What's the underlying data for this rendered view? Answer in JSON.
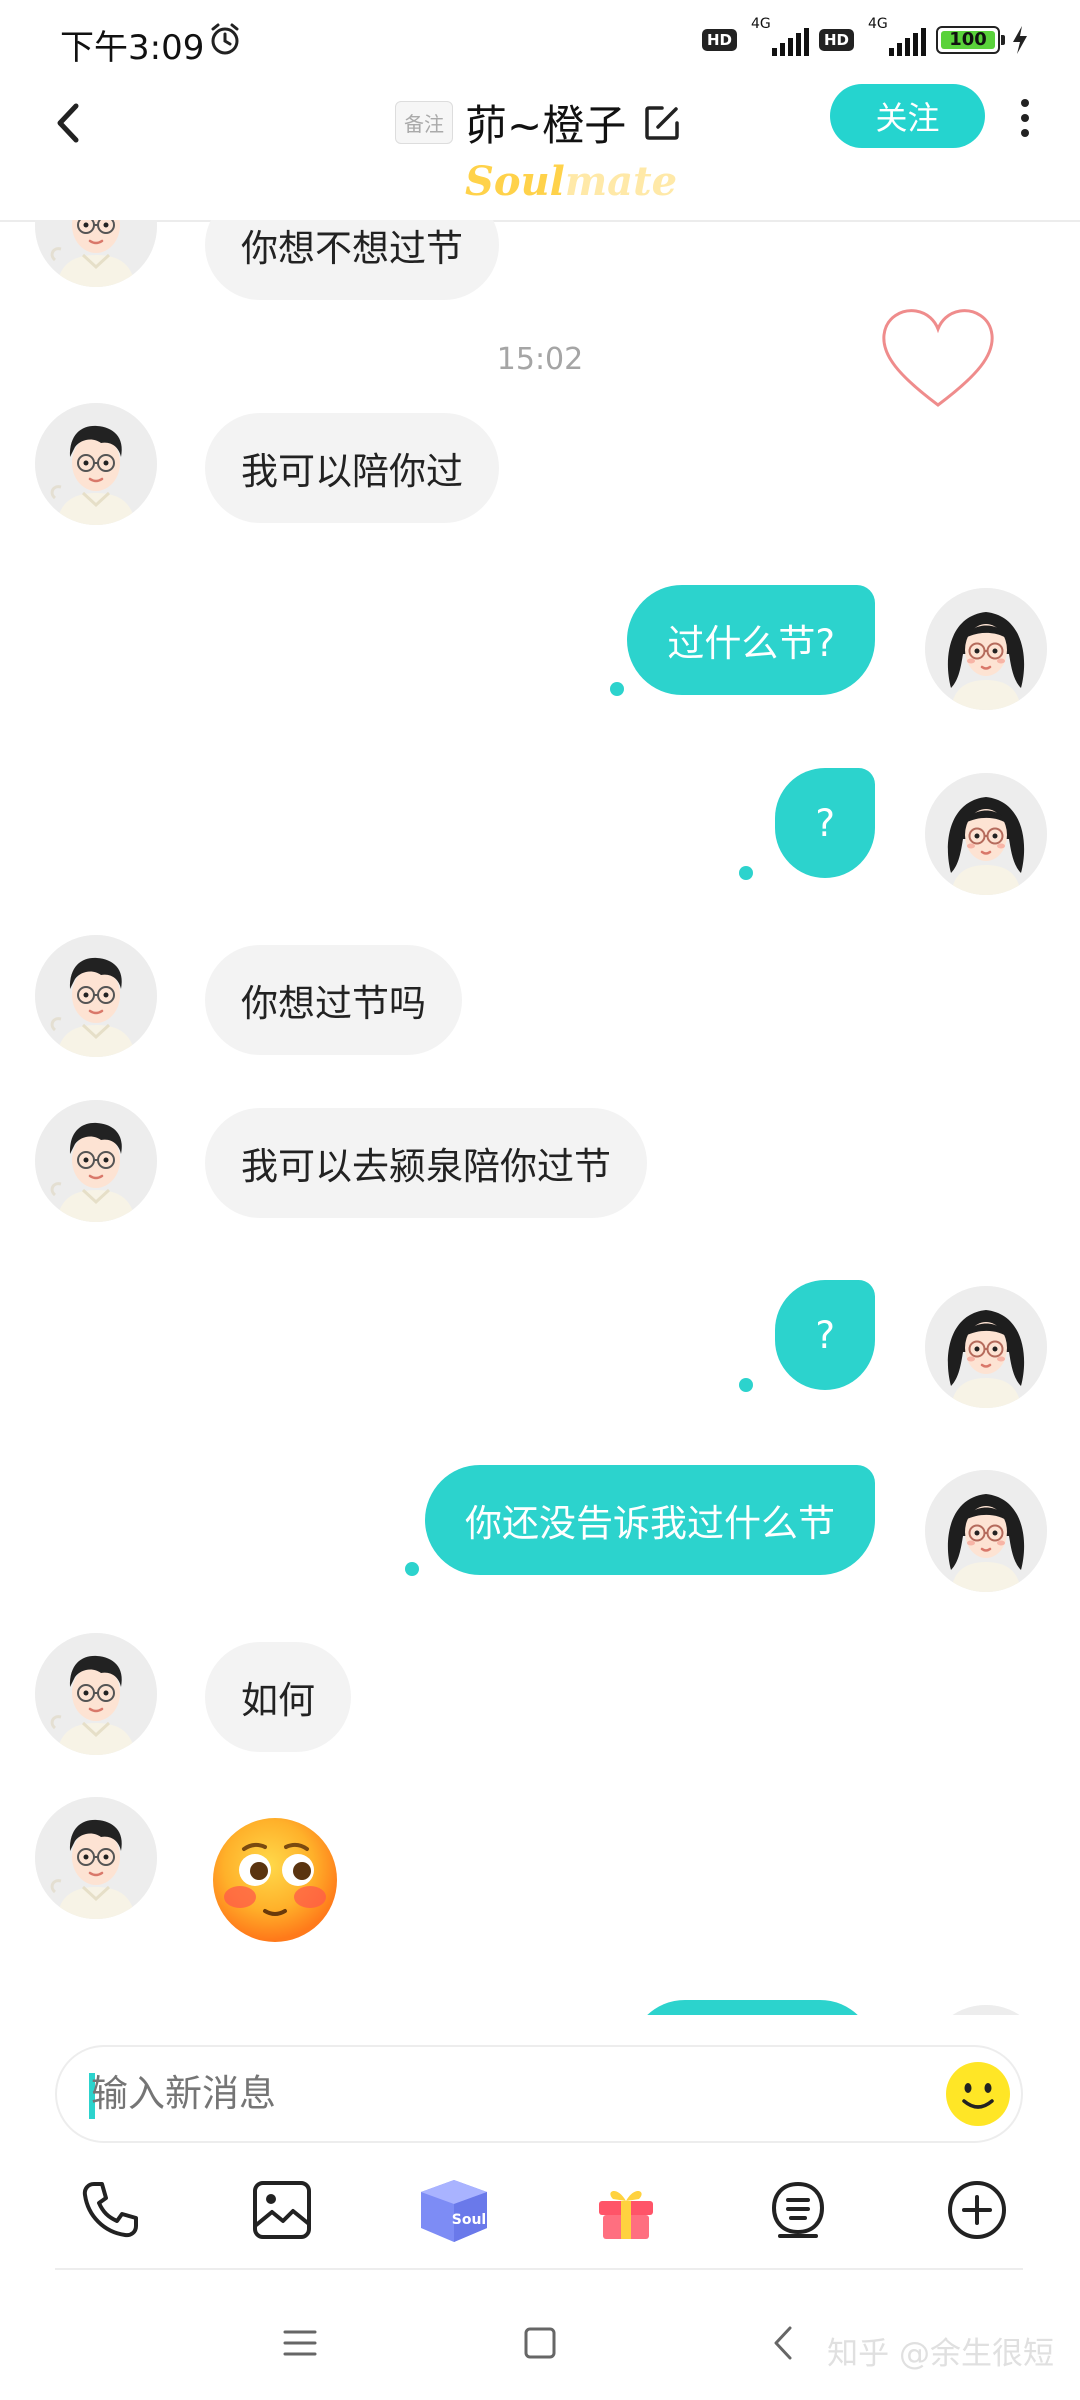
{
  "status_bar": {
    "time": "下午3:09",
    "hd": "HD",
    "network": "4G",
    "battery": "100"
  },
  "header": {
    "remark_label": "备注",
    "title": "茆~橙子",
    "follow_label": "关注",
    "brand_a": "Soul",
    "brand_b": "mate"
  },
  "messages": [
    {
      "side": "left",
      "text": "你想不想过节"
    },
    {
      "timestamp": "15:02"
    },
    {
      "side": "left",
      "text": "我可以陪你过"
    },
    {
      "side": "right",
      "text": "过什么节?"
    },
    {
      "side": "right",
      "text": "?"
    },
    {
      "side": "left",
      "text": "你想过节吗"
    },
    {
      "side": "left",
      "text": "我可以去颍泉陪你过节"
    },
    {
      "side": "right",
      "text": "?"
    },
    {
      "side": "right",
      "text": "你还没告诉我过什么节"
    },
    {
      "side": "left",
      "text": "如何"
    },
    {
      "side": "left",
      "type": "emoji",
      "emoji": "flushed-face"
    }
  ],
  "input": {
    "placeholder": "输入新消息"
  },
  "toolbar": {
    "items": [
      "phone-icon",
      "image-icon",
      "soul-box-icon",
      "gift-icon",
      "voice-icon",
      "add-icon"
    ],
    "soul_box_text": "Soul"
  },
  "watermark": "知乎 @余生很短",
  "colors": {
    "accent": "#2cd3cd",
    "bubble_left": "#f3f3f3",
    "follow": "#25d4cf"
  }
}
